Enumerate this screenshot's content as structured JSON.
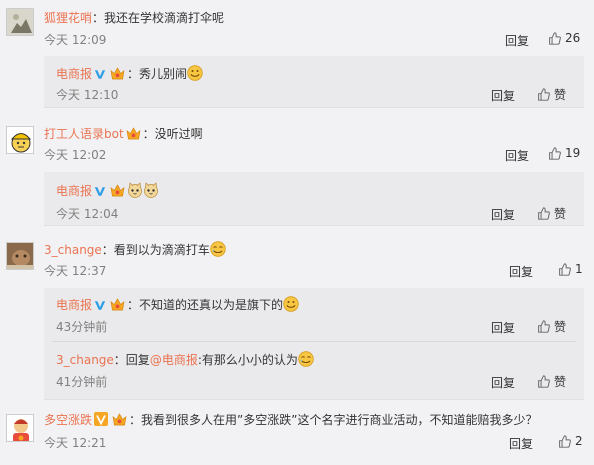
{
  "comments": [
    {
      "user": "狐狸花哨",
      "text": "：我还在学校滴滴打伞呢",
      "time": "今天 12:09",
      "reply": "回复",
      "likes": "26",
      "subs": [
        {
          "user": "电商报",
          "text": "：秀儿别闹",
          "time": "今天 12:10",
          "reply": "回复",
          "like": "赞"
        }
      ]
    },
    {
      "user": "打工人语录bot",
      "text": "：没听过啊",
      "time": "今天 12:02",
      "reply": "回复",
      "likes": "19",
      "subs": [
        {
          "user": "电商报",
          "text": "",
          "time": "今天 12:04",
          "reply": "回复",
          "like": "赞"
        }
      ]
    },
    {
      "user": "3_change",
      "text": "：看到以为滴滴打车",
      "time": "今天 12:37",
      "reply": "回复",
      "likes": "1",
      "subs": [
        {
          "user": "电商报",
          "text": "：不知道的还真以为是旗下的",
          "time": "43分钟前",
          "reply": "回复",
          "like": "赞"
        },
        {
          "user": "3_change",
          "text": "：回复",
          "mention": "@电商报",
          "text2": ":有那么小小的认为",
          "time": "41分钟前",
          "reply": "回复",
          "like": "赞"
        }
      ]
    },
    {
      "user": "多空涨跌",
      "text": "：我看到很多人在用”多空涨跌”这个名字进行商业活动，不知道能赔我多少？",
      "time": "今天 12:21",
      "reply": "回复",
      "likes": "2"
    }
  ],
  "colors": {
    "username": "#eb7350",
    "mention": "#eb7350",
    "sub_bg": "#eaeaec",
    "verify_blue": "#2e9fe6",
    "badge": "#f5a623"
  }
}
